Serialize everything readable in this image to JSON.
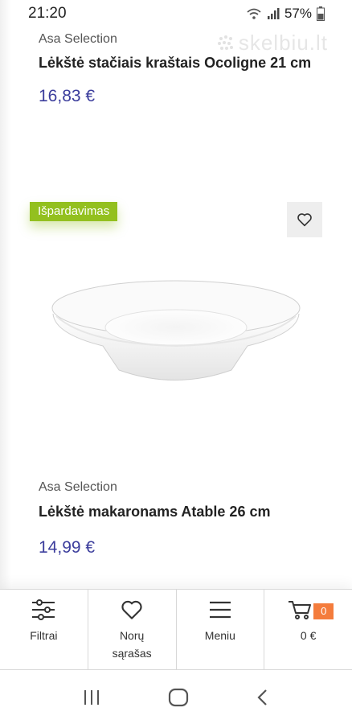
{
  "status_bar": {
    "time": "21:20",
    "battery": "57%"
  },
  "watermark": {
    "text": "skelbiu.lt"
  },
  "products": [
    {
      "brand": "Asa Selection",
      "title": "Lėkštė stačiais kraštais Ocoligne 21 cm",
      "price": "16,83 €"
    },
    {
      "brand": "Asa Selection",
      "title": "Lėkštė makaronams Atable 26 cm",
      "price": "14,99 €",
      "badge": "Išpardavimas"
    }
  ],
  "bottom_nav": {
    "filters": "Filtrai",
    "wishlist": "Norų sąrašas",
    "menu": "Meniu",
    "cart_total": "0 €",
    "cart_count": "0"
  },
  "icons": {
    "filter": "sliders-icon",
    "wishlist": "heart-icon",
    "menu": "hamburger-icon",
    "cart": "cart-icon"
  },
  "colors": {
    "price": "#3b3d9c",
    "badge": "#93c01f",
    "cart_badge": "#f47c3c"
  }
}
